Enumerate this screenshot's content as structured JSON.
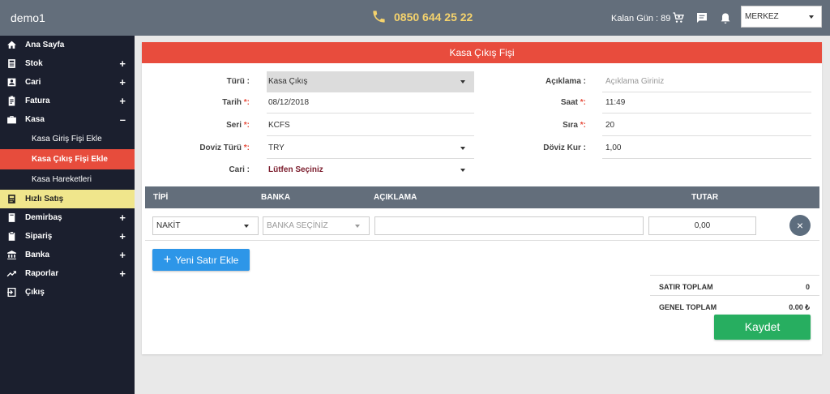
{
  "app": {
    "brand": "demo1",
    "phone": "0850 644 25 22",
    "kalan_gun": "Kalan Gün : 89",
    "store": "MERKEZ"
  },
  "colors": {
    "topbar": "#636e7b",
    "sidebar": "#1b1f2e",
    "accent_red": "#e84c3d",
    "highlight": "#f0e68c",
    "blue": "#2d96e8",
    "green": "#27ae60"
  },
  "sidebar": {
    "items": [
      {
        "label": "Ana Sayfa",
        "icon": "home-icon",
        "toggle": ""
      },
      {
        "label": "Stok",
        "icon": "stock-icon",
        "toggle": "+"
      },
      {
        "label": "Cari",
        "icon": "contact-icon",
        "toggle": "+"
      },
      {
        "label": "Fatura",
        "icon": "invoice-icon",
        "toggle": "+"
      },
      {
        "label": "Kasa",
        "icon": "briefcase-icon",
        "toggle": "–"
      }
    ],
    "sub_items": [
      {
        "label": "Kasa Giriş Fişi Ekle"
      },
      {
        "label": "Kasa Çıkış Fişi Ekle"
      },
      {
        "label": "Kasa Hareketleri"
      }
    ],
    "items2": [
      {
        "label": "Hızlı Satış",
        "icon": "pos-icon",
        "toggle": ""
      },
      {
        "label": "Demirbaş",
        "icon": "book-icon",
        "toggle": "+"
      },
      {
        "label": "Sipariş",
        "icon": "clipboard-icon",
        "toggle": "+"
      },
      {
        "label": "Banka",
        "icon": "bank-icon",
        "toggle": "+"
      },
      {
        "label": "Raporlar",
        "icon": "trend-icon",
        "toggle": "+"
      },
      {
        "label": "Çıkış",
        "icon": "logout-icon",
        "toggle": ""
      }
    ]
  },
  "form": {
    "title": "Kasa Çıkış Fişi",
    "turu_label": "Türü :",
    "turu_value": "Kasa Çıkış",
    "tarih_label": "Tarih",
    "tarih_value": "08/12/2018",
    "seri_label": "Seri",
    "seri_value": "KCFS",
    "doviz_turu_label": "Doviz Türü",
    "doviz_turu_value": "TRY",
    "cari_label": "Cari :",
    "cari_value": "Lütfen Seçiniz",
    "aciklama_label": "Açıklama :",
    "aciklama_placeholder": "Açıklama Giriniz",
    "saat_label": "Saat",
    "saat_value": "11:49",
    "sira_label": "Sıra",
    "sira_value": "20",
    "doviz_kur_label": "Döviz Kur :",
    "doviz_kur_value": "1,00",
    "required_mark": "*:"
  },
  "table": {
    "headers": [
      "TİPİ",
      "BANKA",
      "AÇIKLAMA",
      "TUTAR"
    ],
    "row": {
      "tipi": "NAKİT",
      "banka_placeholder": "BANKA SEÇİNİZ",
      "aciklama": "",
      "tutar": "0,00"
    },
    "add_row": "Yeni Satır Ekle"
  },
  "totals": {
    "satir_label": "SATIR TOPLAM",
    "satir_value": "0",
    "genel_label": "GENEL TOPLAM",
    "genel_value": "0.00 ₺"
  },
  "save_label": "Kaydet"
}
